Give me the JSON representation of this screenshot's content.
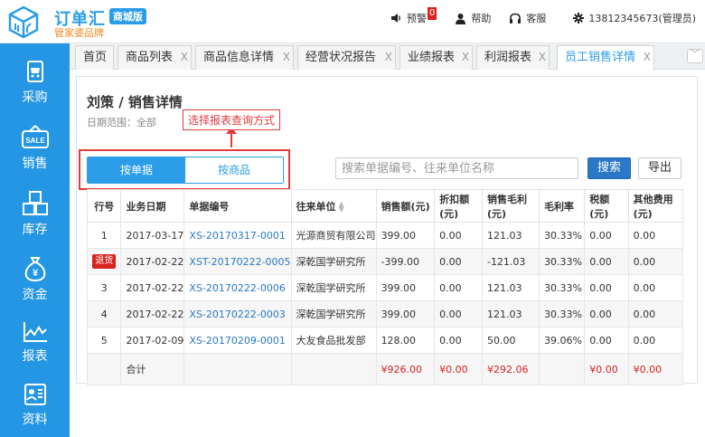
{
  "brand": {
    "name": "订单汇",
    "badge": "商城版",
    "sub": "管家婆品牌"
  },
  "topbar": {
    "alert_label": "预警",
    "alert_count": "0",
    "help_label": "帮助",
    "service_label": "客服",
    "user_label": "13812345673(管理员)"
  },
  "sidebar": {
    "items": [
      {
        "label": "采购",
        "icon": "cart-icon"
      },
      {
        "label": "销售",
        "icon": "sale-tag-icon"
      },
      {
        "label": "库存",
        "icon": "boxes-icon"
      },
      {
        "label": "资金",
        "icon": "money-bag-icon"
      },
      {
        "label": "报表",
        "icon": "chart-line-icon"
      },
      {
        "label": "资料",
        "icon": "id-card-icon"
      }
    ]
  },
  "tabs": [
    {
      "label": "首页"
    },
    {
      "label": "商品列表",
      "close": "X"
    },
    {
      "label": "商品信息详情",
      "close": "X"
    },
    {
      "label": "经营状况报告",
      "close": "X"
    },
    {
      "label": "业绩报表",
      "close": "X"
    },
    {
      "label": "利润报表",
      "close": "X"
    },
    {
      "label": "员工销售详情",
      "close": "X"
    }
  ],
  "tab_more": "﹀",
  "page": {
    "title": "刘策 / 销售详情",
    "range": "日期范围：全部"
  },
  "callout": "选择报表查询方式",
  "segment": {
    "by_doc": "按单据",
    "by_product": "按商品"
  },
  "search": {
    "placeholder": "搜索单据编号、往来单位名称",
    "button": "搜索",
    "export": "导出"
  },
  "table": {
    "headers": [
      "行号",
      "业务日期",
      "单据编号",
      "往来单位",
      "销售额(元)",
      "折扣额(元)",
      "销售毛利(元)",
      "毛利率",
      "税额(元)",
      "其他费用(元)"
    ],
    "rows": [
      {
        "no": "1",
        "date": "2017-03-17",
        "doc": "XS-20170317-0001",
        "party": "光源商贸有限公司",
        "sales": "399.00",
        "discount": "0.00",
        "profit": "121.03",
        "rate": "30.33%",
        "tax": "0.00",
        "other": "0.00"
      },
      {
        "no": "退货",
        "date": "2017-02-22",
        "doc": "XST-20170222-0005",
        "party": "深乾国学研究所",
        "sales": "-399.00",
        "discount": "0.00",
        "profit": "-121.03",
        "rate": "30.33%",
        "tax": "0.00",
        "other": "0.00"
      },
      {
        "no": "3",
        "date": "2017-02-22",
        "doc": "XS-20170222-0006",
        "party": "深乾国学研究所",
        "sales": "399.00",
        "discount": "0.00",
        "profit": "121.03",
        "rate": "30.33%",
        "tax": "0.00",
        "other": "0.00"
      },
      {
        "no": "4",
        "date": "2017-02-22",
        "doc": "XS-20170222-0003",
        "party": "深乾国学研究所",
        "sales": "399.00",
        "discount": "0.00",
        "profit": "121.03",
        "rate": "30.33%",
        "tax": "0.00",
        "other": "0.00"
      },
      {
        "no": "5",
        "date": "2017-02-09",
        "doc": "XS-20170209-0001",
        "party": "大友食品批发部",
        "sales": "128.00",
        "discount": "0.00",
        "profit": "50.00",
        "rate": "39.06%",
        "tax": "0.00",
        "other": "0.00"
      }
    ],
    "total": {
      "label": "合计",
      "sales": "¥926.00",
      "discount": "¥0.00",
      "profit": "¥292.06",
      "tax": "¥0.00",
      "other": "¥0.00"
    }
  },
  "colors": {
    "primary": "#2496e3",
    "accent_orange": "#f08a1c",
    "alert_red": "#d9231d",
    "link": "#2a78c6"
  }
}
